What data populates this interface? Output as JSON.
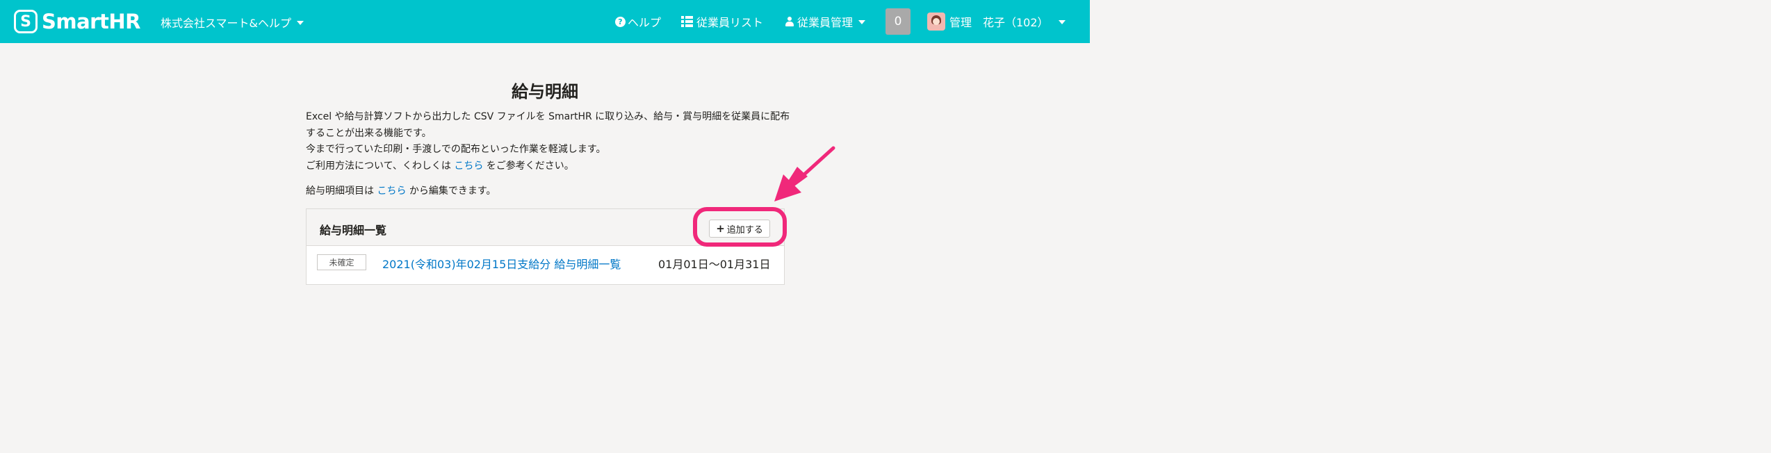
{
  "header": {
    "logo_mark": "S",
    "logo_text": "SmartHR",
    "company": "株式会社スマート&ヘルプ",
    "nav": {
      "help": "ヘルプ",
      "employee_list": "従業員リスト",
      "employee_manage": "従業員管理"
    },
    "notification_count": "0",
    "user_name": "管理　花子（102）"
  },
  "main": {
    "title": "給与明細",
    "description_line1": "Excel や給与計算ソフトから出力した CSV ファイルを SmartHR に取り込み、給与・賞与明細を従業員に配布することが出来る機能です。",
    "description_line2": "今まで行っていた印刷・手渡しでの配布といった作業を軽減します。",
    "usage_prefix": "ご利用方法について、くわしくは ",
    "usage_link": "こちら",
    "usage_suffix": " をご参考ください。",
    "items_prefix": "給与明細項目は ",
    "items_link": "こちら",
    "items_suffix": " から編集できます。"
  },
  "panel": {
    "title": "給与明細一覧",
    "add_button": "追加する",
    "rows": [
      {
        "status": "未確定",
        "name": "2021(令和03)年02月15日支給分 給与明細一覧",
        "period": "01月01日〜01月31日"
      }
    ]
  },
  "colors": {
    "header_bg": "#00c4cc",
    "link": "#0077c7",
    "annotation": "#f0287a"
  }
}
